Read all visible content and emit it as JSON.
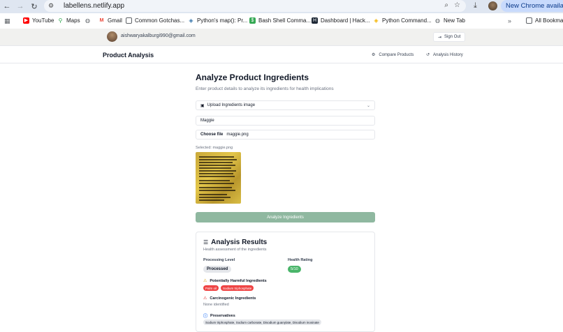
{
  "browser": {
    "url": "labellens.netlify.app",
    "chrome_update_label": "New Chrome available"
  },
  "bookmarks": [
    {
      "label": "YouTube",
      "icon": "youtube-icon",
      "color": "#ff0000"
    },
    {
      "label": "Maps",
      "icon": "maps-icon",
      "color": "#34a853"
    },
    {
      "label": "",
      "icon": "globe-icon",
      "color": "#5f6368"
    },
    {
      "label": "Gmail",
      "icon": "gmail-icon",
      "color": "#ea4335"
    },
    {
      "label": "Common Gotchas...",
      "icon": "doc-icon",
      "color": "#5f6368"
    },
    {
      "label": "Python's map(): Pr...",
      "icon": "python-icon",
      "color": "#3776ab"
    },
    {
      "label": "Bash Shell Comma...",
      "icon": "bash-icon",
      "color": "#34a853"
    },
    {
      "label": "Dashboard | Hack...",
      "icon": "hackerrank-icon",
      "color": "#1f2937"
    },
    {
      "label": "Python Command...",
      "icon": "python-icon",
      "color": "#f4b400"
    },
    {
      "label": "New Tab",
      "icon": "globe-icon",
      "color": "#5f6368"
    }
  ],
  "bookmarks_overflow": "»",
  "all_bookmarks": "All Bookmar",
  "app": {
    "user_email": "aishwaryakalburgi990@gmail.com",
    "sign_out_label": "Sign Out",
    "brand": "Product Analysis",
    "nav": {
      "compare": "Compare Products",
      "history": "Analysis History"
    }
  },
  "form": {
    "title": "Analyze Product Ingredients",
    "subtitle": "Enter product details to analyze its ingredients for health implications",
    "upload_select": "Upload Ingredients image",
    "product_name": "Maggie",
    "choose_file_label": "Choose file",
    "file_name": "maggie.png",
    "selected_text": "Selected: maggie.png",
    "analyze_button": "Analyze Ingredients"
  },
  "results": {
    "title": "Analysis Results",
    "subtitle": "Health assessment of the ingredients",
    "processing_label": "Processing Level",
    "processing_value": "Processed",
    "rating_label": "Health Rating",
    "rating_value": "5/10",
    "harmful_label": "Potentially Harmful Ingredients",
    "harmful_items": [
      "Palm oil",
      "Sodium triphosphate"
    ],
    "carcinogenic_label": "Carcinogenic Ingredients",
    "carcinogenic_value": "None identified",
    "preservatives_label": "Preservatives",
    "preservatives_value": "Sodium triphosphate, Sodium carbonate, Disodium guanylate, Disodium inosinate"
  },
  "colors": {
    "accent_green": "#8fb8a0",
    "rating_green": "#4ab56a",
    "chip_red": "#ef4444"
  }
}
